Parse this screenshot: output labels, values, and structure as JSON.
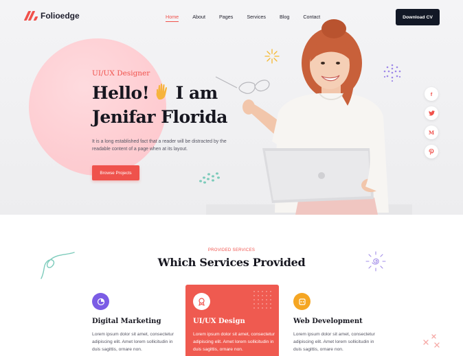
{
  "brand": {
    "name": "Folioedge",
    "accent": "#f0514b",
    "dark": "#121826"
  },
  "nav": {
    "items": [
      {
        "label": "Home",
        "active": true
      },
      {
        "label": "About",
        "active": false
      },
      {
        "label": "Pages",
        "active": false
      },
      {
        "label": "Services",
        "active": false
      },
      {
        "label": "Blog",
        "active": false
      },
      {
        "label": "Contact",
        "active": false
      }
    ],
    "cta_label": "Download CV"
  },
  "hero": {
    "role": "UI/UX Designer",
    "greeting": "Hello!",
    "greeting_suffix": "I am",
    "name": "Jenifar Florida",
    "intro": "It is a long established fact that a reader will be distracted by the readable content of a page when at its layout.",
    "cta_label": "Browse Projects"
  },
  "social": [
    {
      "icon": "facebook-icon",
      "glyph": "f"
    },
    {
      "icon": "twitter-icon",
      "glyph": "❧"
    },
    {
      "icon": "gmail-icon",
      "glyph": "M"
    },
    {
      "icon": "pinterest-icon",
      "glyph": "P"
    }
  ],
  "services": {
    "eyebrow": "PROVIDED SERVICES",
    "title": "Which Services Provided",
    "cards": [
      {
        "title": "Digital Marketing",
        "text": "Lorem ipsum dolor sit amet, consectetur adipiscing elit. Amet lorem sollicitudin in duis sagittis, ornare non.",
        "icon": "pie-chart-icon",
        "icon_color": "#7b5ce5",
        "active": false
      },
      {
        "title": "UI/UX Design",
        "text": "Lorem ipsum dolor sit amet, consectetur adipiscing elit. Amet lorem sollicitudin in duis sagittis, ornare non.",
        "icon": "design-badge-icon",
        "icon_color": "#ffffff",
        "active": true
      },
      {
        "title": "Web Development",
        "text": "Lorem ipsum dolor sit amet, consectetur adipiscing elit. Amet lorem sollicitudin in duis sagittis, ornare non.",
        "icon": "code-icon",
        "icon_color": "#f5a623",
        "active": false
      }
    ]
  }
}
